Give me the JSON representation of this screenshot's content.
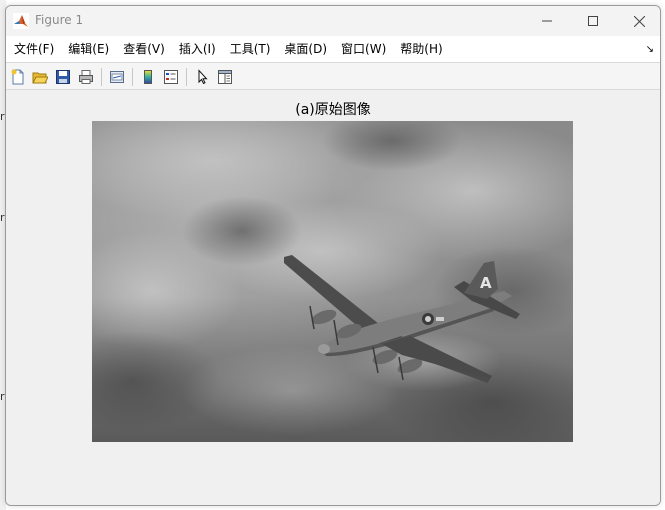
{
  "window": {
    "title": "Figure 1"
  },
  "menu": {
    "items": [
      "文件(F)",
      "编辑(E)",
      "查看(V)",
      "插入(I)",
      "工具(T)",
      "桌面(D)",
      "窗口(W)",
      "帮助(H)"
    ],
    "overflow_arrow": "↘"
  },
  "toolbar": {
    "icons": [
      "new-figure-icon",
      "open-file-icon",
      "save-icon",
      "print-icon",
      "link-plot-icon",
      "colorbar-icon",
      "legend-icon",
      "pointer-icon",
      "property-editor-icon"
    ]
  },
  "figure": {
    "title": "(a)原始图像",
    "image_description_colors": {
      "sky_light": "#b4b4b4",
      "sky_dark": "#6a6a6a",
      "aircraft": "#4a4a4a"
    }
  },
  "background": {
    "chars": [
      "r",
      "r",
      "r",
      "r"
    ]
  },
  "colors": {
    "window_bg": "#f0f0f0",
    "menubar_bg": "#ffffff",
    "title_text": "#8a8a8a"
  }
}
